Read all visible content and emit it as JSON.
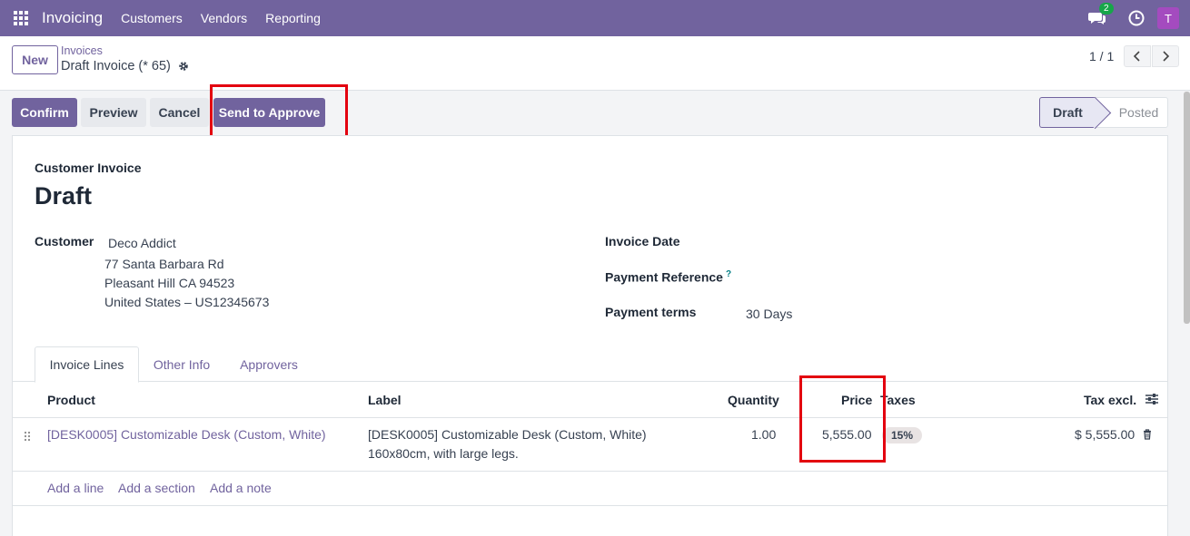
{
  "navbar": {
    "brand": "Invoicing",
    "menu": [
      "Customers",
      "Vendors",
      "Reporting"
    ],
    "chat_badge": "2",
    "avatar_letter": "T",
    "icons": [
      "apps-grid-icon",
      "chat-icon",
      "clock-icon"
    ]
  },
  "control_panel": {
    "new_label": "New",
    "breadcrumb": "Invoices",
    "record_title": "Draft Invoice (* 65)",
    "pager": "1 / 1"
  },
  "actions": {
    "confirm": "Confirm",
    "preview": "Preview",
    "cancel": "Cancel",
    "send_to_approve": "Send to Approve"
  },
  "status": {
    "draft": "Draft",
    "posted": "Posted"
  },
  "document": {
    "type": "Customer Invoice",
    "state": "Draft"
  },
  "customer": {
    "label": "Customer",
    "name": "Deco Addict",
    "address_line1": "77 Santa Barbara Rd",
    "address_line2": "Pleasant Hill CA 94523",
    "address_line3": "United States – US12345673"
  },
  "fields": {
    "invoice_date_label": "Invoice Date",
    "payment_reference_label": "Payment Reference",
    "payment_reference_help": "?",
    "payment_terms_label": "Payment terms",
    "payment_terms_value": "30 Days"
  },
  "tabs": [
    "Invoice Lines",
    "Other Info",
    "Approvers"
  ],
  "table": {
    "headers": {
      "product": "Product",
      "label": "Label",
      "quantity": "Quantity",
      "price": "Price",
      "taxes": "Taxes",
      "tax_excl": "Tax excl."
    },
    "rows": [
      {
        "product": "[DESK0005] Customizable Desk (Custom, White)",
        "label_line1": "[DESK0005] Customizable Desk (Custom, White)",
        "label_line2": "160x80cm, with large legs.",
        "quantity": "1.00",
        "price": "5,555.00",
        "tax": "15%",
        "tax_excl": "$ 5,555.00"
      }
    ],
    "add_line": "Add a line",
    "add_section": "Add a section",
    "add_note": "Add a note"
  },
  "colors": {
    "brand": "#71639e",
    "highlight": "#e3000f",
    "badge_green": "#17a64a",
    "avatar": "#a44bbf"
  }
}
